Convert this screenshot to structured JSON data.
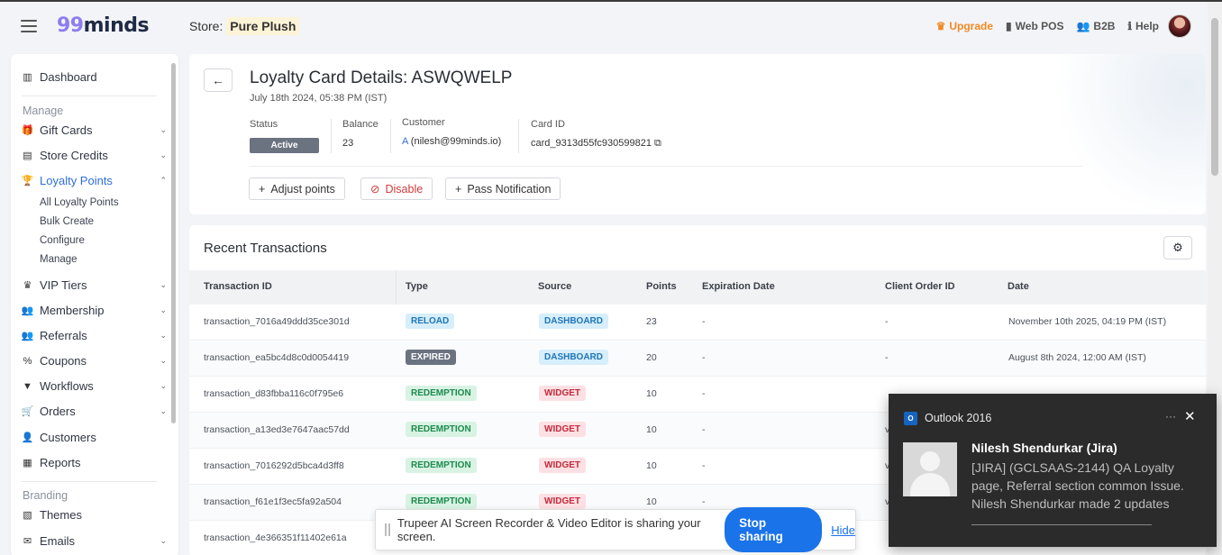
{
  "header": {
    "logo_num": "99",
    "logo_text": "minds",
    "store_label": "Store:",
    "store_name": "Pure Plush",
    "nav": {
      "upgrade": "Upgrade",
      "web_pos": "Web POS",
      "b2b": "B2B",
      "help": "Help"
    }
  },
  "sidebar": {
    "dashboard": "Dashboard",
    "manage_section": "Manage",
    "gift_cards": "Gift Cards",
    "store_credits": "Store Credits",
    "loyalty_points": "Loyalty Points",
    "sub": {
      "all": "All Loyalty Points",
      "bulk": "Bulk Create",
      "configure": "Configure",
      "manage": "Manage"
    },
    "vip_tiers": "VIP Tiers",
    "membership": "Membership",
    "referrals": "Referrals",
    "coupons": "Coupons",
    "workflows": "Workflows",
    "orders": "Orders",
    "customers": "Customers",
    "reports": "Reports",
    "branding_section": "Branding",
    "themes": "Themes",
    "emails": "Emails"
  },
  "card": {
    "title": "Loyalty Card Details: ASWQWELP",
    "subtitle": "July 18th 2024, 05:38 PM (IST)",
    "status_label": "Status",
    "status_value": "Active",
    "balance_label": "Balance",
    "balance_value": "23",
    "customer_label": "Customer",
    "customer_initial": "A",
    "customer_value": "(nilesh@99minds.io)",
    "card_id_label": "Card ID",
    "card_id_value": "card_9313d55fc930599821",
    "actions": {
      "adjust": "Adjust points",
      "disable": "Disable",
      "notify": "Pass Notification"
    }
  },
  "transactions": {
    "title": "Recent Transactions",
    "columns": {
      "id": "Transaction ID",
      "type": "Type",
      "source": "Source",
      "points": "Points",
      "expiration": "Expiration Date",
      "client_order": "Client Order ID",
      "date": "Date"
    },
    "rows": [
      {
        "id": "transaction_7016a49ddd35ce301d",
        "type": "RELOAD",
        "source": "DASHBOARD",
        "points": "23",
        "expiration": "-",
        "client_order": "-",
        "date": "November 10th 2025, 04:19 PM (IST)"
      },
      {
        "id": "transaction_ea5bc4d8c0d0054419",
        "type": "EXPIRED",
        "source": "DASHBOARD",
        "points": "20",
        "expiration": "-",
        "client_order": "-",
        "date": "August 8th 2024, 12:00 AM (IST)"
      },
      {
        "id": "transaction_d83fbba116c0f795e6",
        "type": "REDEMPTION",
        "source": "WIDGET",
        "points": "10",
        "expiration": "-",
        "client_order": "",
        "date": ""
      },
      {
        "id": "transaction_a13ed3e7647aac57dd",
        "type": "REDEMPTION",
        "source": "WIDGET",
        "points": "10",
        "expiration": "-",
        "client_order": "v",
        "date": ""
      },
      {
        "id": "transaction_7016292d5bca4d3ff8",
        "type": "REDEMPTION",
        "source": "WIDGET",
        "points": "10",
        "expiration": "-",
        "client_order": "v",
        "date": ""
      },
      {
        "id": "transaction_f61e1f3ec5fa92a504",
        "type": "REDEMPTION",
        "source": "WIDGET",
        "points": "10",
        "expiration": "-",
        "client_order": "v",
        "date": ""
      },
      {
        "id": "transaction_4e366351f11402e61a",
        "type": "",
        "source": "",
        "points": "",
        "expiration": "",
        "client_order": "",
        "date": ""
      }
    ]
  },
  "sharebar": {
    "message": "Trupeer AI Screen Recorder & Video Editor is sharing your screen.",
    "stop": "Stop sharing",
    "hide": "Hide"
  },
  "toast": {
    "app_icon": "O",
    "app_name": "Outlook 2016",
    "dots": "···",
    "close": "✕",
    "sender": "Nilesh Shendurkar (Jira)",
    "body": "[JIRA] (GCLSAAS-2144) QA Loyalty page, Referral section common Issue. Nilesh Shendurkar made 2 updates"
  }
}
